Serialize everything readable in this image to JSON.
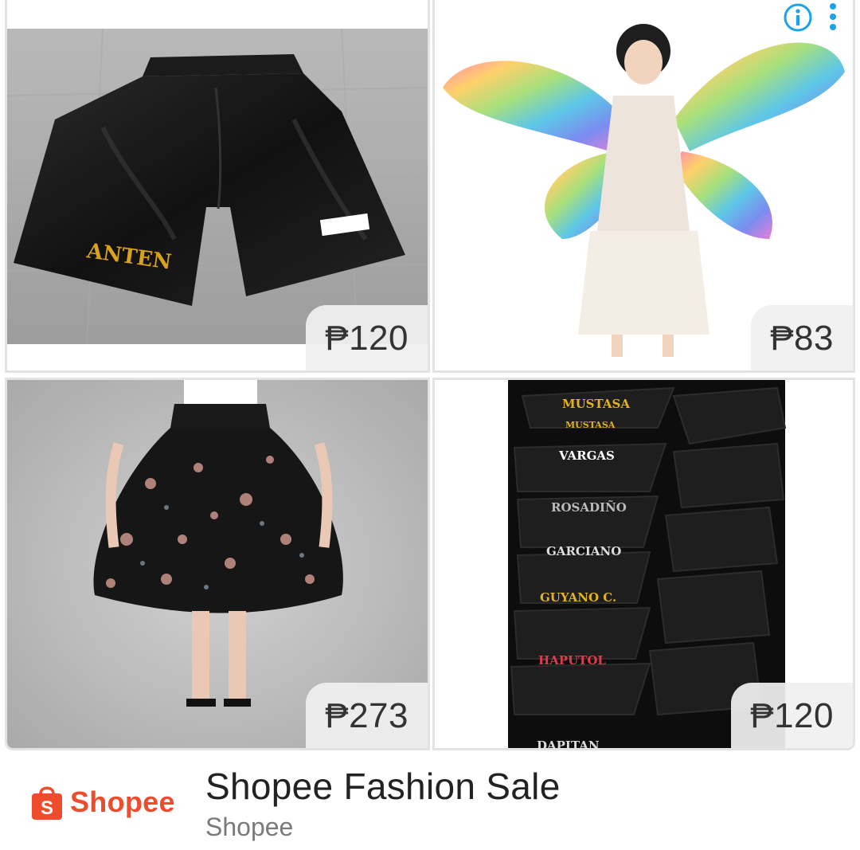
{
  "ad": {
    "headline": "Shopee Fashion Sale",
    "advertiser": "Shopee",
    "brand_logo_text": "Shopee",
    "brand_logo_icon_letter": "S",
    "brand_color": "#ee4d2d",
    "adchoices_icon": "info-icon",
    "menu_icon": "more-vert-icon",
    "adchoices_color": "#1aa3e8"
  },
  "products": [
    {
      "item": "shorts-anten",
      "price": "₱120",
      "print_text": "ANTEN"
    },
    {
      "item": "rainbow-wings",
      "price": "₱83"
    },
    {
      "item": "floral-skirt",
      "price": "₱273"
    },
    {
      "item": "personalized-shorts-stack",
      "price": "₱120",
      "names": [
        "MUSTASA",
        "MUSTASA",
        "VARGAS",
        "ROSADIÑO",
        "GARCIANO",
        "GUYANO C.",
        "HAPUTOL",
        "DAPITAN"
      ]
    }
  ]
}
